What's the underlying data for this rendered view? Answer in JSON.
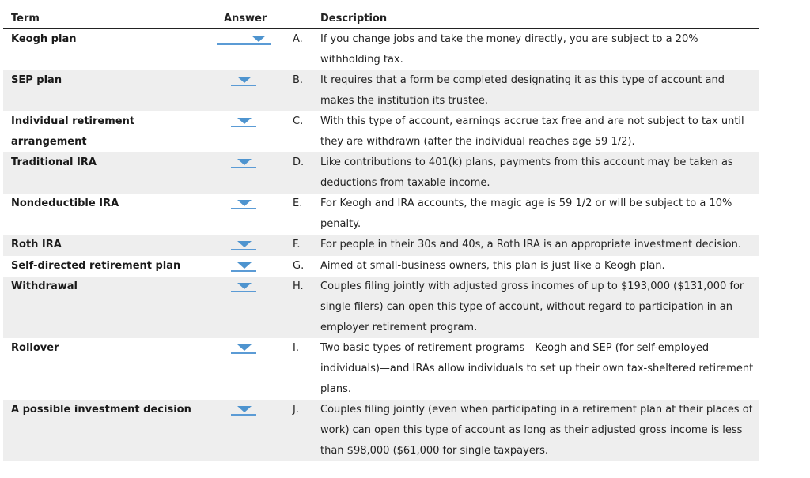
{
  "header": {
    "term": "Term",
    "answer": "Answer",
    "description": "Description"
  },
  "rows": [
    {
      "term": "Keogh plan",
      "answer": "",
      "letter": "A.",
      "description": "If you change jobs and take the money directly, you are subject to a 20% withholding tax."
    },
    {
      "term": "SEP plan",
      "answer": "",
      "letter": "B.",
      "description": "It requires that a form be completed designating it as this type of account and makes the institution its trustee."
    },
    {
      "term": "Individual retirement arrangement",
      "answer": "",
      "letter": "C.",
      "description": "With this type of account, earnings accrue tax free and are not subject to tax until they are withdrawn (after the individual reaches age 59 1/2)."
    },
    {
      "term": "Traditional IRA",
      "answer": "",
      "letter": "D.",
      "description": "Like contributions to 401(k) plans, payments from this account may be taken as deductions from taxable income."
    },
    {
      "term": "Nondeductible IRA",
      "answer": "",
      "letter": "E.",
      "description": "For Keogh and IRA accounts, the magic age is 59 1/2 or will be subject to a 10% penalty."
    },
    {
      "term": "Roth IRA",
      "answer": "",
      "letter": "F.",
      "description": "For people in their 30s and 40s, a Roth IRA is an appropriate investment decision."
    },
    {
      "term": "Self-directed retirement plan",
      "answer": "",
      "letter": "G.",
      "description": "Aimed at small-business owners, this plan is just like a Keogh plan."
    },
    {
      "term": "Withdrawal",
      "answer": "",
      "letter": "H.",
      "description": "Couples filing jointly with adjusted gross incomes of up to $193,000 ($131,000 for single filers) can open this type of account, without regard to participation in an employer retirement program."
    },
    {
      "term": "Rollover",
      "answer": "",
      "letter": "I.",
      "description": "Two basic types of retirement programs—Keogh and SEP (for self-employed individuals)—and IRAs allow individuals to set up their own tax-sheltered retirement plans."
    },
    {
      "term": "A possible investment decision",
      "answer": "",
      "letter": "J.",
      "description": "Couples filing jointly (even when participating in a retirement plan at their places of work) can open this type of account as long as their adjusted gross income is less than $98,000 ($61,000 for single taxpayers."
    }
  ],
  "icons": {
    "dropdown": "chevron-down-icon"
  },
  "colors": {
    "accent": "#4e94cf",
    "row_alt": "#eeeeee"
  }
}
